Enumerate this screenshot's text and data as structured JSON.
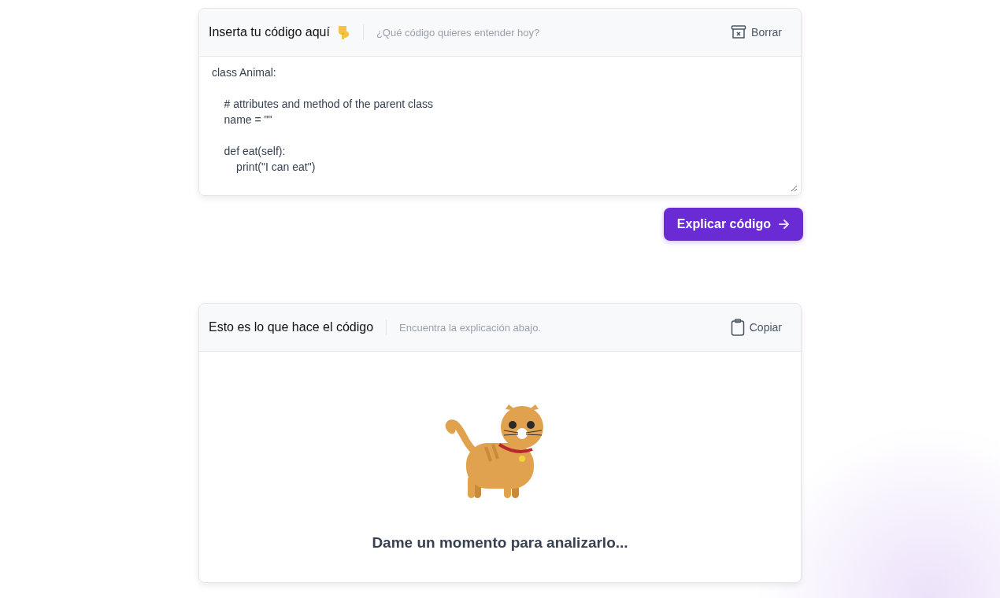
{
  "input_card": {
    "title": "Inserta tu código aquí",
    "hint": "¿Qué código quieres entender hoy?",
    "clear_button": "Borrar",
    "code": "class Animal:\n\n    # attributes and method of the parent class\n    name = \"\"\n\n    def eat(self):\n        print(\"I can eat\")"
  },
  "explain_button": "Explicar código",
  "output_card": {
    "title": "Esto es lo que hace el código",
    "hint": "Encuentra la explicación abajo.",
    "copy_button": "Copiar",
    "status": "Dame un momento para analizarlo..."
  }
}
